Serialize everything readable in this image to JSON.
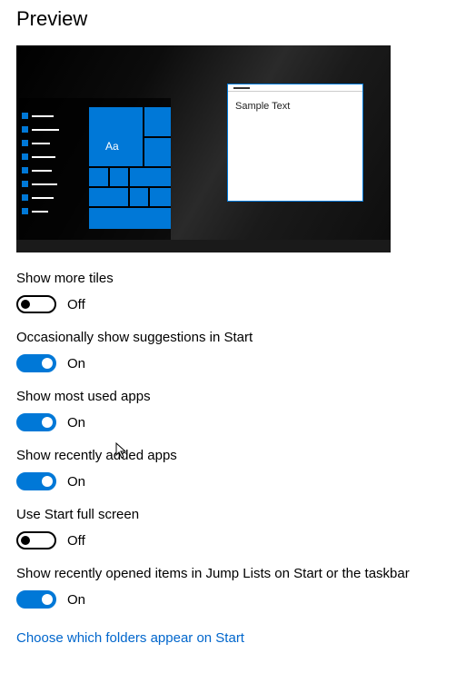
{
  "section_title": "Preview",
  "preview": {
    "tile_label": "Aa",
    "popup_text": "Sample Text"
  },
  "state_labels": {
    "on": "On",
    "off": "Off"
  },
  "settings": {
    "more_tiles": {
      "label": "Show more tiles",
      "on": false
    },
    "suggestions": {
      "label": "Occasionally show suggestions in Start",
      "on": true
    },
    "most_used": {
      "label": "Show most used apps",
      "on": true
    },
    "recently_added": {
      "label": "Show recently added apps",
      "on": true
    },
    "full_screen": {
      "label": "Use Start full screen",
      "on": false
    },
    "jump_lists": {
      "label": "Show recently opened items in Jump Lists on Start or the taskbar",
      "on": true
    }
  },
  "link": {
    "choose_folders": "Choose which folders appear on Start"
  }
}
